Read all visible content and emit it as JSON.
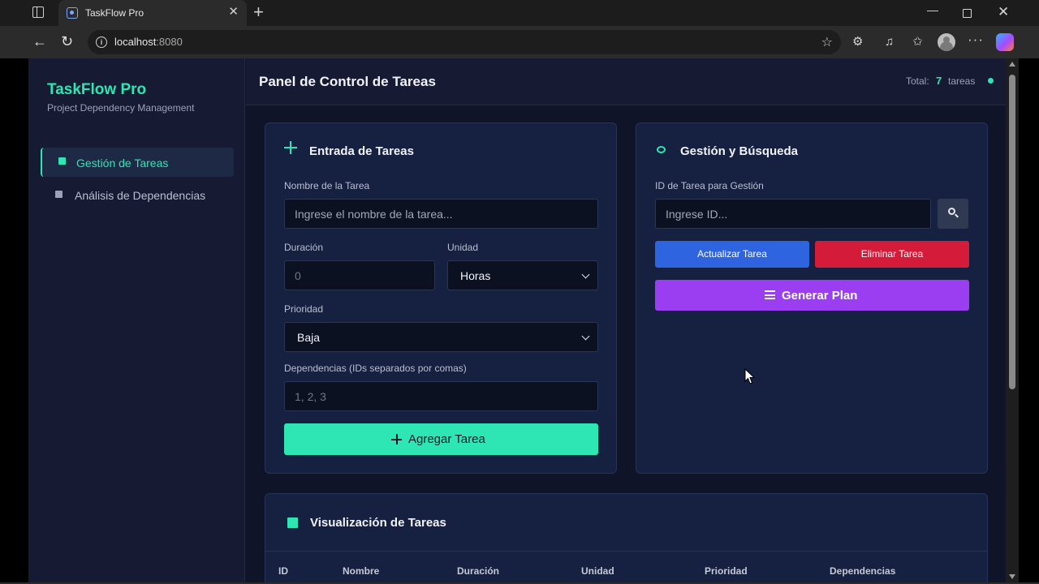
{
  "browser": {
    "tab_title": "TaskFlow Pro",
    "url_host": "localhost",
    "url_port": ":8080"
  },
  "sidebar": {
    "brand": "TaskFlow Pro",
    "subtitle": "Project Dependency Management",
    "items": [
      {
        "label": "Gestión de Tareas",
        "active": true,
        "icon": "briefcase-icon"
      },
      {
        "label": "Análisis de Dependencias",
        "active": false,
        "icon": "shield-icon"
      }
    ]
  },
  "header": {
    "title": "Panel de Control de Tareas",
    "total_label": "Total:",
    "total_count": "7",
    "total_unit": "tareas",
    "status_color": "#2ee6b3"
  },
  "entry": {
    "title": "Entrada de Tareas",
    "name_label": "Nombre de la Tarea",
    "name_placeholder": "Ingrese el nombre de la tarea...",
    "duration_label": "Duración",
    "duration_placeholder": "0",
    "unit_label": "Unidad",
    "unit_value": "Horas",
    "priority_label": "Prioridad",
    "priority_value": "Baja",
    "deps_label": "Dependencias (IDs separados por comas)",
    "deps_placeholder": "1, 2, 3",
    "add_button": "Agregar Tarea"
  },
  "manage": {
    "title": "Gestión y Búsqueda",
    "id_label": "ID de Tarea para Gestión",
    "id_placeholder": "Ingrese ID...",
    "update_button": "Actualizar Tarea",
    "delete_button": "Eliminar Tarea",
    "plan_button": "Generar Plan"
  },
  "visualization": {
    "title": "Visualización de Tareas",
    "columns": [
      "ID",
      "Nombre",
      "Duración",
      "Unidad",
      "Prioridad",
      "Dependencias"
    ]
  },
  "colors": {
    "accent": "#2ee6b3",
    "update": "#2f64e0",
    "delete": "#d41b3a",
    "plan": "#9b3df0"
  }
}
